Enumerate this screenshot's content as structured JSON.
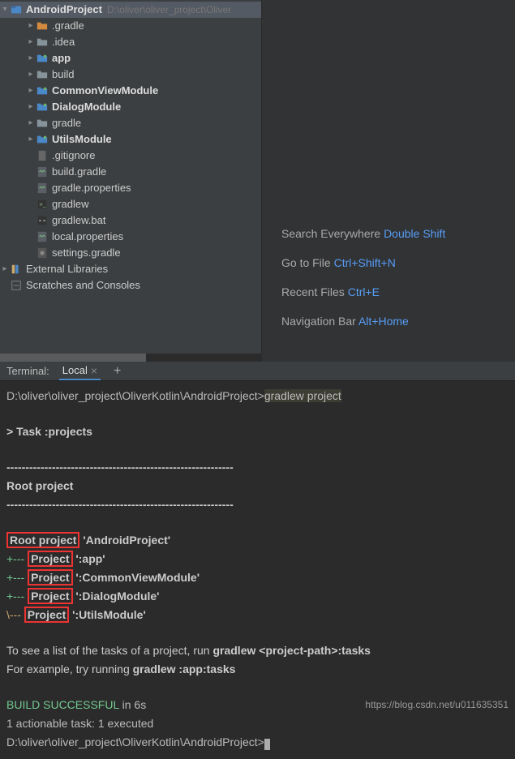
{
  "project_tree": {
    "root": {
      "name": "AndroidProject",
      "path": "D:\\oliver\\oliver_project\\Oliver"
    },
    "items": [
      {
        "indent": 1,
        "expand": "closed",
        "icon": "folder-orange",
        "name": ".gradle",
        "bold": false
      },
      {
        "indent": 1,
        "expand": "closed",
        "icon": "folder",
        "name": ".idea",
        "bold": false
      },
      {
        "indent": 1,
        "expand": "closed",
        "icon": "module",
        "name": "app",
        "bold": true
      },
      {
        "indent": 1,
        "expand": "closed",
        "icon": "folder",
        "name": "build",
        "bold": false
      },
      {
        "indent": 1,
        "expand": "closed",
        "icon": "module",
        "name": "CommonViewModule",
        "bold": true
      },
      {
        "indent": 1,
        "expand": "closed",
        "icon": "module",
        "name": "DialogModule",
        "bold": true
      },
      {
        "indent": 1,
        "expand": "closed",
        "icon": "folder",
        "name": "gradle",
        "bold": false
      },
      {
        "indent": 1,
        "expand": "closed",
        "icon": "module",
        "name": "UtilsModule",
        "bold": true
      },
      {
        "indent": 1,
        "expand": "",
        "icon": "file-dim",
        "name": ".gitignore",
        "bold": false
      },
      {
        "indent": 1,
        "expand": "",
        "icon": "gradle-file",
        "name": "build.gradle",
        "bold": false
      },
      {
        "indent": 1,
        "expand": "",
        "icon": "gradle-file",
        "name": "gradle.properties",
        "bold": false
      },
      {
        "indent": 1,
        "expand": "",
        "icon": "shell-file",
        "name": "gradlew",
        "bold": false
      },
      {
        "indent": 1,
        "expand": "",
        "icon": "bat-file",
        "name": "gradlew.bat",
        "bold": false
      },
      {
        "indent": 1,
        "expand": "",
        "icon": "gradle-file",
        "name": "local.properties",
        "bold": false
      },
      {
        "indent": 1,
        "expand": "",
        "icon": "gradle-file-dim",
        "name": "settings.gradle",
        "bold": false
      }
    ],
    "external": "External Libraries",
    "scratches": "Scratches and Consoles"
  },
  "welcome": {
    "rows": [
      {
        "label": "Search Everywhere",
        "key": "Double Shift"
      },
      {
        "label": "Go to File",
        "key": "Ctrl+Shift+N"
      },
      {
        "label": "Recent Files",
        "key": "Ctrl+E"
      },
      {
        "label": "Navigation Bar",
        "key": "Alt+Home"
      }
    ]
  },
  "terminal": {
    "title": "Terminal:",
    "tab": "Local",
    "lines": {
      "prompt1": "D:\\oliver\\oliver_project\\OliverKotlin\\AndroidProject>",
      "cmd": "gradlew project",
      "task": "> Task :projects",
      "dashes": "------------------------------------------------------------",
      "rootHeading": "Root project",
      "rootProj": "Root project",
      "proj": "Project",
      "rootName": " 'AndroidProject'",
      "p1": " ':app'",
      "p2": " ':CommonViewModule'",
      "p3": " ':DialogModule'",
      "p4": " ':UtilsModule'",
      "hint1a": "To see a list of the tasks of a project, run ",
      "hint1b": "gradlew <project-path>:tasks",
      "hint2a": "For example, try running ",
      "hint2b": "gradlew :app:tasks",
      "buildOk": "BUILD SUCCESSFUL",
      "buildTime": " in 6s",
      "actionable": "1 actionable task: 1 executed",
      "prompt2": "D:\\oliver\\oliver_project\\OliverKotlin\\AndroidProject>",
      "branchPlus": "+--- ",
      "branchEnd": "\\--- "
    }
  },
  "watermark": "https://blog.csdn.net/u011635351"
}
